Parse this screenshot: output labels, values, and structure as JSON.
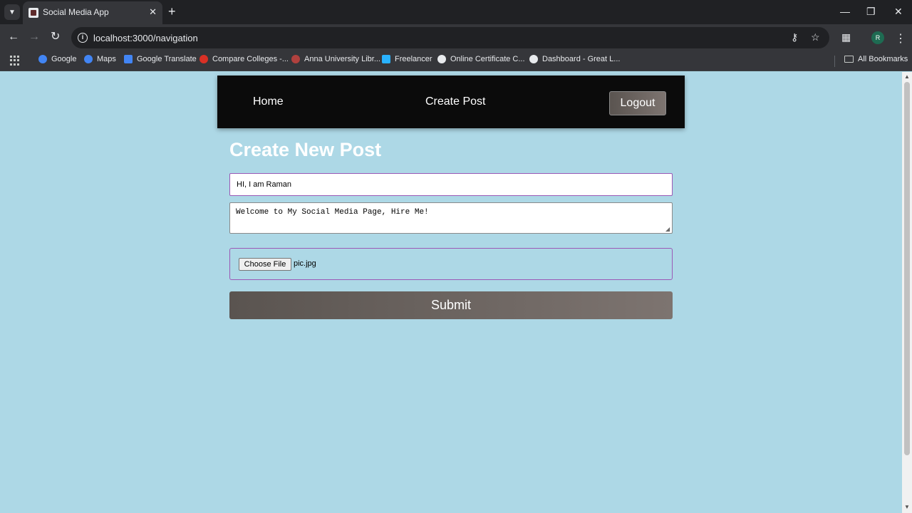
{
  "browser": {
    "tab_title": "Social Media App",
    "url": "localhost:3000/navigation",
    "profile_initial": "R",
    "bookmarks": [
      {
        "label": "Google",
        "icon": "google-icon",
        "color": "#4285f4"
      },
      {
        "label": "Maps",
        "icon": "google-icon",
        "color": "#4285f4"
      },
      {
        "label": "Google Translate",
        "icon": "translate-icon",
        "color": "#4285f4"
      },
      {
        "label": "Compare Colleges -...",
        "icon": "compare-colleges-icon",
        "color": "#d93025"
      },
      {
        "label": "Anna University Libr...",
        "icon": "university-icon",
        "color": "#b0413e"
      },
      {
        "label": "Freelancer",
        "icon": "freelancer-icon",
        "color": "#29b2fe"
      },
      {
        "label": "Online Certificate C...",
        "icon": "google-icon",
        "color": "#e8eaed"
      },
      {
        "label": "Dashboard - Great L...",
        "icon": "google-icon",
        "color": "#e8eaed"
      }
    ],
    "all_bookmarks": "All Bookmarks"
  },
  "nav": {
    "home": "Home",
    "create_post": "Create Post",
    "logout": "Logout"
  },
  "form": {
    "heading": "Create New Post",
    "title_value": "HI, I am Raman",
    "content_value": "Welcome to My Social Media Page, Hire Me!",
    "choose_file": "Choose File",
    "file_name": "pic.jpg",
    "submit": "Submit"
  },
  "colors": {
    "page_background": "#add8e6",
    "navbar_background": "#0b0b0b",
    "input_border_focus": "#9b59b6",
    "button_gradient_start": "#5a5450",
    "button_gradient_end": "#7d7470"
  }
}
